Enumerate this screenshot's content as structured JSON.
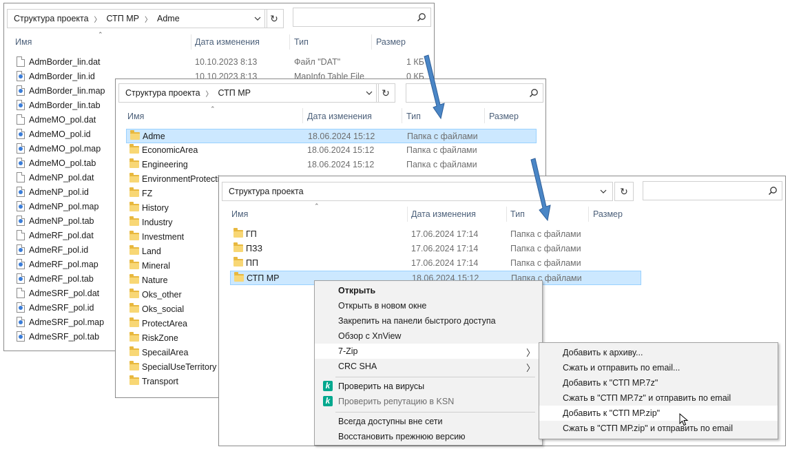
{
  "win1": {
    "breadcrumb": [
      "Структура проекта",
      "СТП МР",
      "Adme"
    ],
    "headers": {
      "name": "Имя",
      "date": "Дата изменения",
      "type": "Тип",
      "size": "Размер"
    },
    "files": [
      {
        "name": "AdmBorder_lin.dat",
        "date": "10.10.2023 8:13",
        "type": "Файл \"DAT\"",
        "size": "1 КБ",
        "icon": "file-icon"
      },
      {
        "name": "AdmBorder_lin.id",
        "date": "10.10.2023 8:13",
        "type": "MapInfo Table File",
        "size": "0 КБ",
        "icon": "mapinfo-icon"
      },
      {
        "name": "AdmBorder_lin.map",
        "icon": "mapinfo-icon"
      },
      {
        "name": "AdmBorder_lin.tab",
        "icon": "mapinfo-icon"
      },
      {
        "name": "AdmeMO_pol.dat",
        "icon": "file-icon"
      },
      {
        "name": "AdmeMO_pol.id",
        "icon": "mapinfo-icon"
      },
      {
        "name": "AdmeMO_pol.map",
        "icon": "mapinfo-icon"
      },
      {
        "name": "AdmeMO_pol.tab",
        "icon": "mapinfo-icon"
      },
      {
        "name": "AdmeNP_pol.dat",
        "icon": "file-icon"
      },
      {
        "name": "AdmeNP_pol.id",
        "icon": "mapinfo-icon"
      },
      {
        "name": "AdmeNP_pol.map",
        "icon": "mapinfo-icon"
      },
      {
        "name": "AdmeNP_pol.tab",
        "icon": "mapinfo-icon"
      },
      {
        "name": "AdmeRF_pol.dat",
        "icon": "file-icon"
      },
      {
        "name": "AdmeRF_pol.id",
        "icon": "mapinfo-icon"
      },
      {
        "name": "AdmeRF_pol.map",
        "icon": "mapinfo-icon"
      },
      {
        "name": "AdmeRF_pol.tab",
        "icon": "mapinfo-icon"
      },
      {
        "name": "AdmeSRF_pol.dat",
        "icon": "file-icon"
      },
      {
        "name": "AdmeSRF_pol.id",
        "icon": "mapinfo-icon"
      },
      {
        "name": "AdmeSRF_pol.map",
        "icon": "mapinfo-icon"
      },
      {
        "name": "AdmeSRF_pol.tab",
        "icon": "mapinfo-icon"
      }
    ]
  },
  "win2": {
    "breadcrumb": [
      "Структура проекта",
      "СТП МР"
    ],
    "headers": {
      "name": "Имя",
      "date": "Дата изменения",
      "type": "Тип",
      "size": "Размер"
    },
    "folders": [
      {
        "name": "Adme",
        "date": "18.06.2024 15:12",
        "type": "Папка с файлами"
      },
      {
        "name": "EconomicArea",
        "date": "18.06.2024 15:12",
        "type": "Папка с файлами"
      },
      {
        "name": "Engineering",
        "date": "18.06.2024 15:12",
        "type": "Папка с файлами"
      },
      {
        "name": "EnvironmentProtectio"
      },
      {
        "name": "FZ"
      },
      {
        "name": "History"
      },
      {
        "name": "Industry"
      },
      {
        "name": "Investment"
      },
      {
        "name": "Land"
      },
      {
        "name": "Mineral"
      },
      {
        "name": "Nature"
      },
      {
        "name": "Oks_other"
      },
      {
        "name": "Oks_social"
      },
      {
        "name": "ProtectArea"
      },
      {
        "name": "RiskZone"
      },
      {
        "name": "SpecailArea"
      },
      {
        "name": "SpecialUseTerritory"
      },
      {
        "name": "Transport"
      }
    ]
  },
  "win3": {
    "breadcrumb": [
      "Структура проекта"
    ],
    "headers": {
      "name": "Имя",
      "date": "Дата изменения",
      "type": "Тип",
      "size": "Размер"
    },
    "folders": [
      {
        "name": "ГП",
        "date": "17.06.2024 17:14",
        "type": "Папка с файлами"
      },
      {
        "name": "ПЗЗ",
        "date": "17.06.2024 17:14",
        "type": "Папка с файлами"
      },
      {
        "name": "ПП",
        "date": "17.06.2024 17:14",
        "type": "Папка с файлами"
      },
      {
        "name": "СТП МР",
        "date": "18.06.2024 15:12",
        "type": "Папка с файлами"
      }
    ]
  },
  "context_menu": {
    "items": [
      {
        "label": "Открыть"
      },
      {
        "label": "Открыть в новом окне"
      },
      {
        "label": "Закрепить на панели быстрого доступа"
      },
      {
        "label": "Обзор с XnView"
      },
      {
        "label": "7-Zip"
      },
      {
        "label": "CRC SHA"
      },
      {
        "label": "Проверить на вирусы"
      },
      {
        "label": "Проверить репутацию в KSN"
      },
      {
        "label": "Всегда доступны вне сети"
      },
      {
        "label": "Восстановить прежнюю версию"
      }
    ]
  },
  "submenu": {
    "items": [
      {
        "label": "Добавить к архиву..."
      },
      {
        "label": "Сжать и отправить по email..."
      },
      {
        "label": "Добавить к \"СТП МР.7z\""
      },
      {
        "label": "Сжать в \"СТП МР.7z\" и отправить по email"
      },
      {
        "label": "Добавить к \"СТП МР.zip\""
      },
      {
        "label": "Сжать в \"СТП МР.zip\" и отправить по email"
      }
    ]
  },
  "colors": {
    "selection": "#cce8ff",
    "arrow": "#4a86c6",
    "folder": "#f8d775",
    "kaspersky": "#00a88e"
  }
}
